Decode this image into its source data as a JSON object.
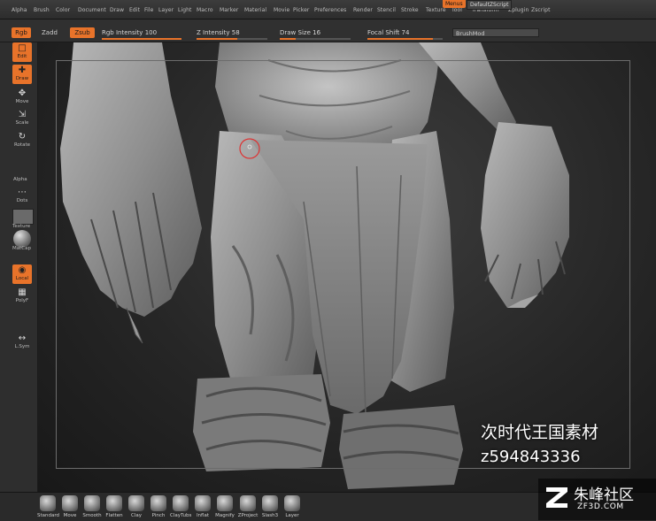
{
  "menubar": {
    "items": [
      "Alpha",
      "Brush",
      "Color",
      "Document",
      "Draw",
      "Edit",
      "File",
      "Layer",
      "Light",
      "Macro",
      "Marker",
      "Material",
      "Movie",
      "Picker",
      "Preferences",
      "Render",
      "Stencil",
      "Stroke",
      "Texture",
      "Tool",
      "Transform",
      "Zplugin",
      "Zscript"
    ],
    "hotkey_label": "Menus",
    "script_label": "DefaultZScript"
  },
  "topbar": {
    "rgb_label": "Rgb",
    "zadd_label": "Zadd",
    "zsub_label": "Zsub",
    "rgb_intensity": {
      "label": "Rgb Intensity",
      "value": 100
    },
    "z_intensity": {
      "label": "Z Intensity",
      "value": 58
    },
    "draw_size": {
      "label": "Draw Size",
      "value": 16
    },
    "focal_shift": {
      "label": "Focal Shift",
      "value": 74
    },
    "brushmod_label": "BrushMod"
  },
  "left_tools": {
    "edit": "Edit",
    "draw": "Draw",
    "move": "Move",
    "scale": "Scale",
    "rotate": "Rotate",
    "alpha": "Alpha",
    "dots": "Dots",
    "texture": "Texture",
    "matcap": "MatCap",
    "local": "Local",
    "polyf": "PolyF",
    "lsym": "L.Sym"
  },
  "brushes": [
    "Standard",
    "Move",
    "Smooth",
    "Flatten",
    "Clay",
    "Pinch",
    "ClayTubs",
    "Inflat",
    "Magnify",
    "ZProject",
    "Slash3",
    "Layer"
  ],
  "watermark": {
    "line1": "次时代王国素材",
    "line2": "z594843336"
  },
  "logo": {
    "title": "朱峰社区",
    "url": "ZF3D.COM"
  },
  "colors": {
    "accent": "#e8732a",
    "panel": "#2e2e2e",
    "viewport": "#2a2a2a"
  }
}
